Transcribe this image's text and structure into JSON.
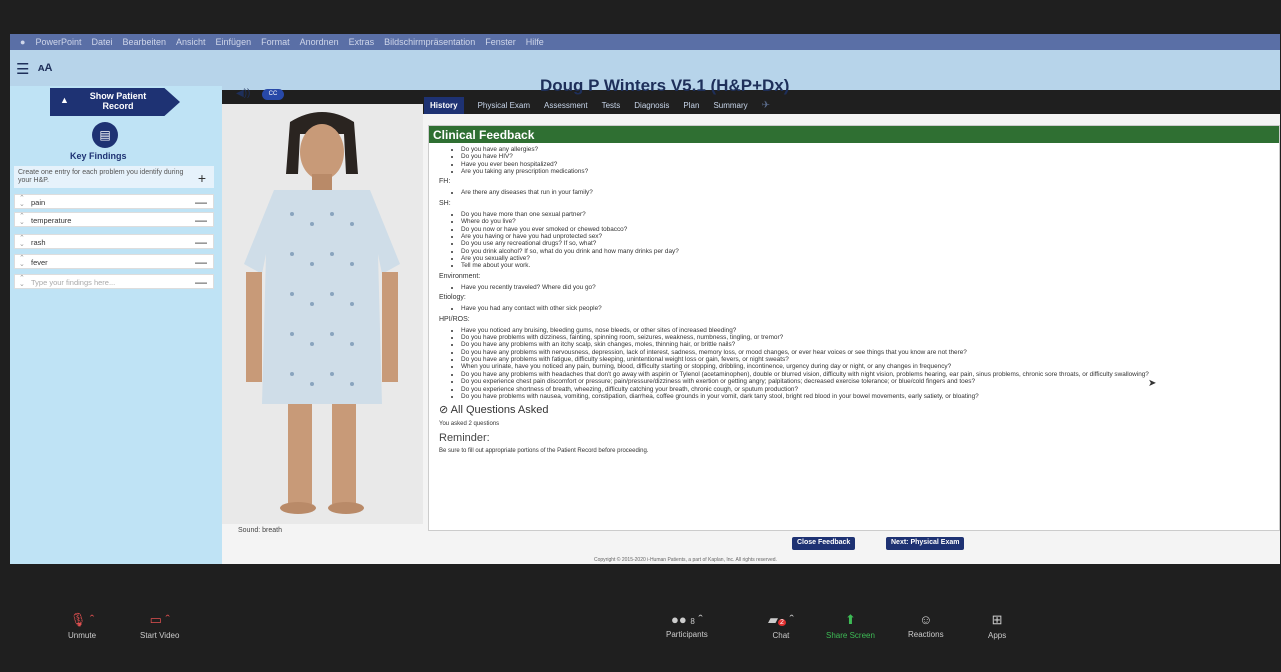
{
  "menubar": [
    "PowerPoint",
    "Datei",
    "Bearbeiten",
    "Ansicht",
    "Einfügen",
    "Format",
    "Anordnen",
    "Extras",
    "Bildschirmpräsentation",
    "Fenster",
    "Hilfe"
  ],
  "app": {
    "title": "Doug P Winters V5.1 (H&P+Dx)"
  },
  "left": {
    "show_record": "Show Patient Record",
    "key_findings": "Key Findings",
    "instruction": "Create one entry for each problem you identify during your H&P.",
    "findings": [
      "pain",
      "temperature",
      "rash",
      "fever"
    ],
    "placeholder": "Type your findings here..."
  },
  "patient": {
    "sound_label": "Sound: breath",
    "cc": "CC"
  },
  "tabs": [
    "History",
    "Physical Exam",
    "Assessment",
    "Tests",
    "Diagnosis",
    "Plan",
    "Summary"
  ],
  "feedback": {
    "heading": "Clinical Feedback",
    "top_items": [
      "Do you have any allergies?",
      "Do you have HIV?",
      "Have you ever been hospitalized?",
      "Are you taking any prescription medications?"
    ],
    "fh_label": "FH:",
    "fh_items": [
      "Are there any diseases that run in your family?"
    ],
    "sh_label": "SH:",
    "sh_items": [
      "Do you have more than one sexual partner?",
      "Where do you live?",
      "Do you now or have you ever smoked or chewed tobacco?",
      "Are you having or have you had unprotected sex?",
      "Do you use any recreational drugs? If so, what?",
      "Do you drink alcohol? If so, what do you drink and how many drinks per day?",
      "Are you sexually active?",
      "Tell me about your work."
    ],
    "env_label": "Environment:",
    "env_items": [
      "Have you recently traveled? Where did you go?"
    ],
    "eti_label": "Etiology:",
    "eti_items": [
      "Have you had any contact with other sick people?"
    ],
    "hpi_label": "HPI/ROS:",
    "hpi_items": [
      "Have you noticed any bruising, bleeding gums, nose bleeds, or other sites of increased bleeding?",
      "Do you have problems with dizziness, fainting, spinning room, seizures, weakness, numbness, tingling, or tremor?",
      "Do you have any problems with an itchy scalp, skin changes, moles, thinning hair, or brittle nails?",
      "Do you have any problems with nervousness, depression, lack of interest, sadness, memory loss, or mood changes, or ever hear voices or see things that you know are not there?",
      "Do you have any problems with fatigue, difficulty sleeping, unintentional weight loss or gain, fevers, or night sweats?",
      "When you urinate, have you noticed any pain, burning, blood, difficulty starting or stopping, dribbling, incontinence, urgency during day or night, or any changes in frequency?",
      "Do you have any problems with headaches that don't go away with aspirin or Tylenol (acetaminophen), double or blurred vision, difficulty with night vision, problems hearing, ear pain, sinus problems, chronic sore throats, or difficulty swallowing?",
      "Do you experience chest pain discomfort or pressure; pain/pressure/dizziness with exertion or getting angry; palpitations; decreased exercise tolerance; or blue/cold fingers and toes?",
      "Do you experience shortness of breath, wheezing, difficulty catching your breath, chronic cough, or sputum production?",
      "Do you have problems with nausea, vomiting, constipation, diarrhea, coffee grounds in your vomit, dark tarry stool, bright red blood in your bowel movements, early satiety, or bloating?"
    ],
    "all_asked": "All Questions Asked",
    "asked_count": "You asked 2 questions",
    "reminder": "Reminder:",
    "reminder_text": "Be sure to fill out appropriate portions of the Patient Record before proceeding."
  },
  "buttons": {
    "close": "Close Feedback",
    "next": "Next: Physical Exam"
  },
  "copyright": "Copyright © 2015-2020 i-Human Patients, a part of Kaplan, Inc. All rights reserved.",
  "zoom": {
    "unmute": "Unmute",
    "video": "Start Video",
    "participants": "Participants",
    "participants_count": "8",
    "chat": "Chat",
    "chat_badge": "2",
    "share": "Share Screen",
    "reactions": "Reactions",
    "apps": "Apps"
  }
}
